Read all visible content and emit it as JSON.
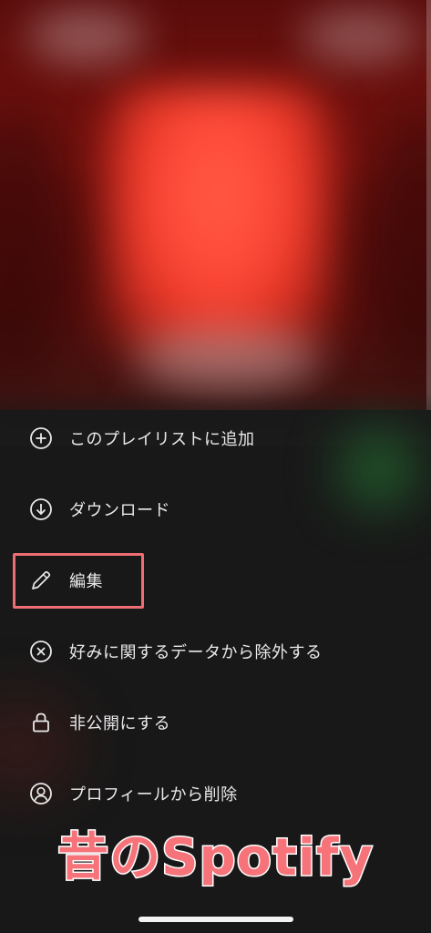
{
  "menu": {
    "items": [
      {
        "label": "このプレイリストに追加",
        "icon": "add-circle-icon"
      },
      {
        "label": "ダウンロード",
        "icon": "download-circle-icon"
      },
      {
        "label": "編集",
        "icon": "pencil-icon"
      },
      {
        "label": "好みに関するデータから除外する",
        "icon": "exclude-circle-icon"
      },
      {
        "label": "非公開にする",
        "icon": "lock-icon"
      },
      {
        "label": "プロフィールから削除",
        "icon": "profile-remove-icon"
      }
    ]
  },
  "caption": {
    "text": "昔のSpotify",
    "color": "#f6737a"
  },
  "highlight": {
    "color": "#ee6d72"
  },
  "colors": {
    "background": "#181818",
    "text": "#e9e9e9",
    "artwork_accent": "#ff4a38"
  }
}
